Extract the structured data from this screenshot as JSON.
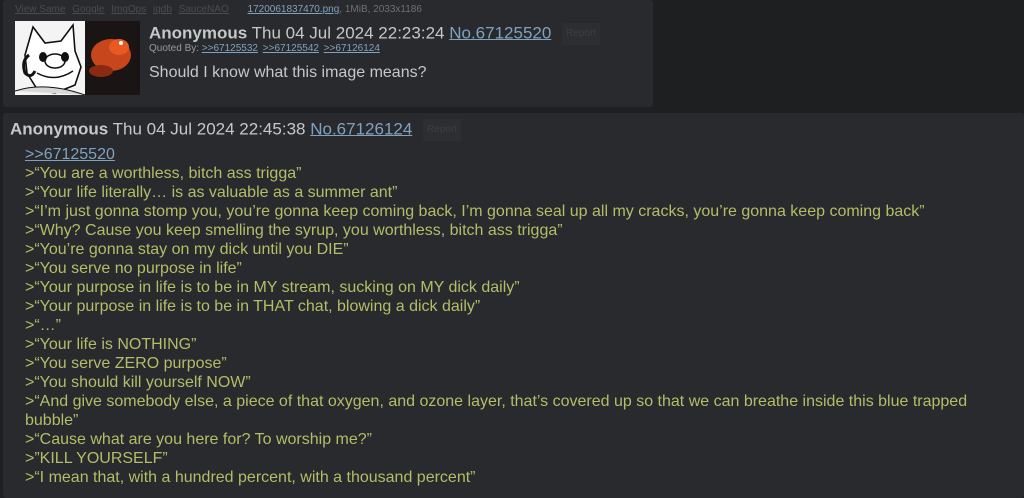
{
  "post1": {
    "search_links": [
      "View Same",
      "Google",
      "ImgOps",
      "iqdb",
      "SauceNAO"
    ],
    "filename": "1720061837470.png",
    "filemeta": ", 1MiB, 2033x1186",
    "name": "Anonymous",
    "date": "Thu 04 Jul 2024 22:23:24",
    "number": "No.67125520",
    "report_label": "Report",
    "quoted_by_label": "Quoted By:",
    "quoted_by": [
      ">>67125532",
      ">>67125542",
      ">>67126124"
    ],
    "message": "Should I know what this image means?"
  },
  "post2": {
    "name": "Anonymous",
    "date": "Thu 04 Jul 2024 22:45:38",
    "number": "No.67126124",
    "report_label": "Report",
    "reply_link": ">>67125520",
    "lines": [
      ">“You are a worthless, bitch ass trigga”",
      ">“Your life literally… is as valuable as a summer ant”",
      ">“I’m just gonna stomp you, you’re gonna keep coming back, I’m gonna seal up all my cracks, you’re gonna keep coming back”",
      ">“Why? Cause you keep smelling the syrup, you worthless, bitch ass trigga”",
      ">“You’re gonna stay on my dick until you DIE”",
      ">“You serve no purpose in life”",
      ">“Your purpose in life is to be in MY stream, sucking on MY dick daily”",
      ">“Your purpose in life is to be in THAT chat, blowing a dick daily”",
      ">“…”",
      ">“Your life is NOTHING”",
      ">“You serve ZERO purpose”",
      ">“You should kill yourself NOW”",
      ">“And give somebody else, a piece of that oxygen, and ozone layer, that’s covered up so that we can breathe inside this blue trapped bubble”",
      ">“Cause what are you here for? To worship me?”",
      ">”KILL YOURSELF”",
      ">“I mean that, with a hundred percent, with a thousand percent”"
    ]
  }
}
